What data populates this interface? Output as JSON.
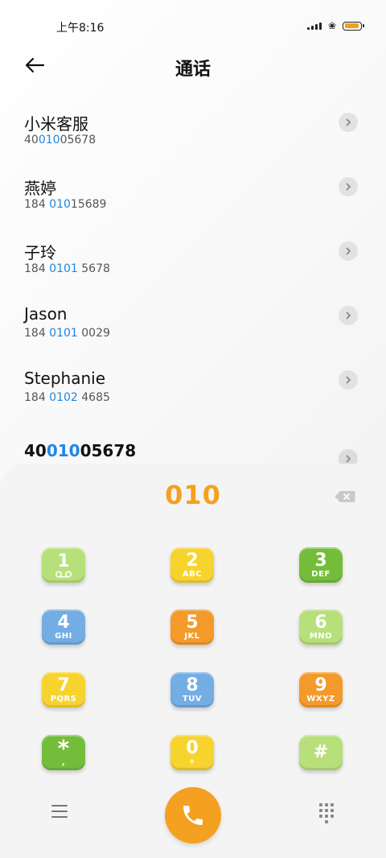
{
  "status": {
    "time": "上午8:16",
    "battery_level": 0.75,
    "battery_color": "#f0a21a"
  },
  "header": {
    "title": "通话"
  },
  "contacts": [
    {
      "name": "小米客服",
      "number_pre": "40",
      "number_hl": "010",
      "number_post": "05678"
    },
    {
      "name": "燕婷",
      "number_pre": "184 ",
      "number_hl": "010",
      "number_post": "15689"
    },
    {
      "name": "子玲",
      "number_pre": "184 ",
      "number_hl": "0101",
      "number_post": " 5678"
    },
    {
      "name": "Jason",
      "number_pre": "184 ",
      "number_hl": "0101",
      "number_post": " 0029"
    },
    {
      "name": "Stephanie",
      "number_pre": "184 ",
      "number_hl": "0102",
      "number_post": " 4685"
    }
  ],
  "match": {
    "pre": "40",
    "hl": "010",
    "post": "05678"
  },
  "dialer": {
    "input": "010",
    "keys": [
      {
        "digit": "1",
        "letters": ""
      },
      {
        "digit": "2",
        "letters": "ABC"
      },
      {
        "digit": "3",
        "letters": "DEF"
      },
      {
        "digit": "4",
        "letters": "GHI"
      },
      {
        "digit": "5",
        "letters": "JKL"
      },
      {
        "digit": "6",
        "letters": "MNO"
      },
      {
        "digit": "7",
        "letters": "PQRS"
      },
      {
        "digit": "8",
        "letters": "TUV"
      },
      {
        "digit": "9",
        "letters": "WXYZ"
      },
      {
        "digit": "*",
        "letters": ","
      },
      {
        "digit": "0",
        "letters": "+"
      },
      {
        "digit": "#",
        "letters": ""
      }
    ]
  },
  "colors": {
    "accent": "#f4a020",
    "highlight": "#1f86e6"
  },
  "icons": {
    "back": "arrow-left-icon",
    "chevron": "chevron-right-icon",
    "delete": "backspace-icon",
    "menu": "menu-icon",
    "call": "phone-icon",
    "keypad": "keypad-icon",
    "voicemail": "voicemail-icon"
  }
}
